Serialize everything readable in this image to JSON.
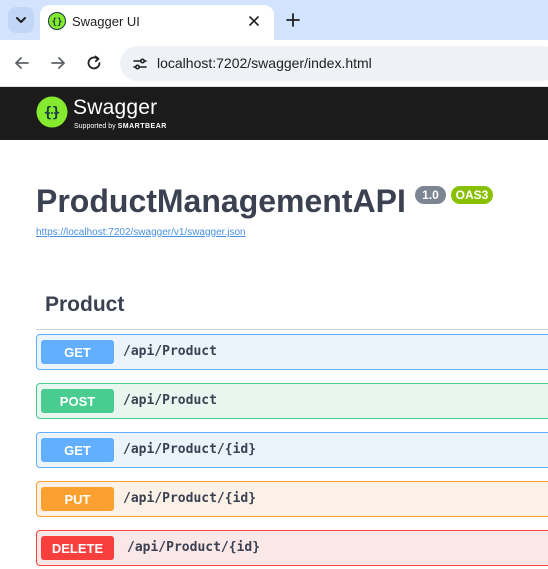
{
  "browser": {
    "tab_title": "Swagger UI",
    "url": "localhost:7202/swagger/index.html"
  },
  "swagger": {
    "logo_text": "Swagger",
    "supported_by": "Supported by",
    "smartbear": "SMARTBEAR"
  },
  "info": {
    "title": "ProductManagementAPI",
    "version": "1.0",
    "oas": "OAS3",
    "spec_url": "https://localhost:7202/swagger/v1/swagger.json"
  },
  "tag": {
    "name": "Product"
  },
  "operations": [
    {
      "method": "GET",
      "path": "/api/Product"
    },
    {
      "method": "POST",
      "path": "/api/Product"
    },
    {
      "method": "GET",
      "path": "/api/Product/{id}"
    },
    {
      "method": "PUT",
      "path": "/api/Product/{id}"
    },
    {
      "method": "DELETE",
      "path": "/api/Product/{id}"
    }
  ],
  "colors": {
    "get": "#61affe",
    "post": "#49cc90",
    "put": "#fca130",
    "delete": "#f93e3e",
    "swagger_green": "#85ea2d",
    "topbar": "#1b1b1b"
  }
}
